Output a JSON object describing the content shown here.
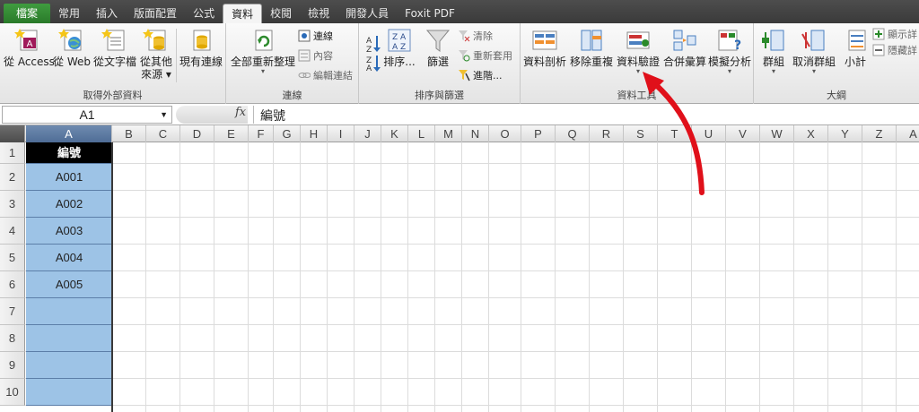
{
  "tabs": [
    {
      "label": "檔案",
      "kind": "file"
    },
    {
      "label": "常用"
    },
    {
      "label": "插入"
    },
    {
      "label": "版面配置"
    },
    {
      "label": "公式"
    },
    {
      "label": "資料",
      "active": true
    },
    {
      "label": "校閱"
    },
    {
      "label": "檢視"
    },
    {
      "label": "開發人員"
    },
    {
      "label": "Foxit PDF"
    }
  ],
  "ribbon": {
    "external": {
      "group_label": "取得外部資料",
      "from_access": "從 Access",
      "from_web": "從 Web",
      "from_text": "從文字檔",
      "from_other_1": "從其他",
      "from_other_2": "來源",
      "existing": "現有連線"
    },
    "connections": {
      "group_label": "連線",
      "refresh_all": "全部重新整理",
      "connections": "連線",
      "properties": "內容",
      "edit_links": "編輯連結"
    },
    "sort": {
      "group_label": "排序與篩選",
      "sort": "排序...",
      "filter": "篩選",
      "clear": "清除",
      "reapply": "重新套用",
      "advanced": "進階..."
    },
    "datatools": {
      "group_label": "資料工具",
      "text_to_columns": "資料剖析",
      "remove_duplicates": "移除重複",
      "validation": "資料驗證",
      "consolidate": "合併彙算",
      "what_if": "模擬分析"
    },
    "outline": {
      "group_label": "大綱",
      "group": "群組",
      "ungroup": "取消群組",
      "subtotal": "小計",
      "show_detail": "顯示詳",
      "hide_detail": "隱藏詳"
    }
  },
  "formula_bar": {
    "name_box": "A1",
    "fx": "fx",
    "value": "編號"
  },
  "columns": [
    "A",
    "B",
    "C",
    "D",
    "E",
    "F",
    "G",
    "H",
    "I",
    "J",
    "K",
    "L",
    "M",
    "N",
    "O",
    "P",
    "Q",
    "R",
    "S",
    "T",
    "U",
    "V",
    "W",
    "X",
    "Y",
    "Z",
    "A"
  ],
  "rows": [
    "1",
    "2",
    "3",
    "4",
    "5",
    "6",
    "7",
    "8",
    "9",
    "10"
  ],
  "cells_A": [
    "編號",
    "A001",
    "A002",
    "A003",
    "A004",
    "A005",
    "",
    "",
    "",
    ""
  ],
  "colors": {
    "selected_fill": "#9dc3e6",
    "header_fill": "#000000",
    "arrow": "#e0101a",
    "file_tab": "#2e7d32"
  }
}
